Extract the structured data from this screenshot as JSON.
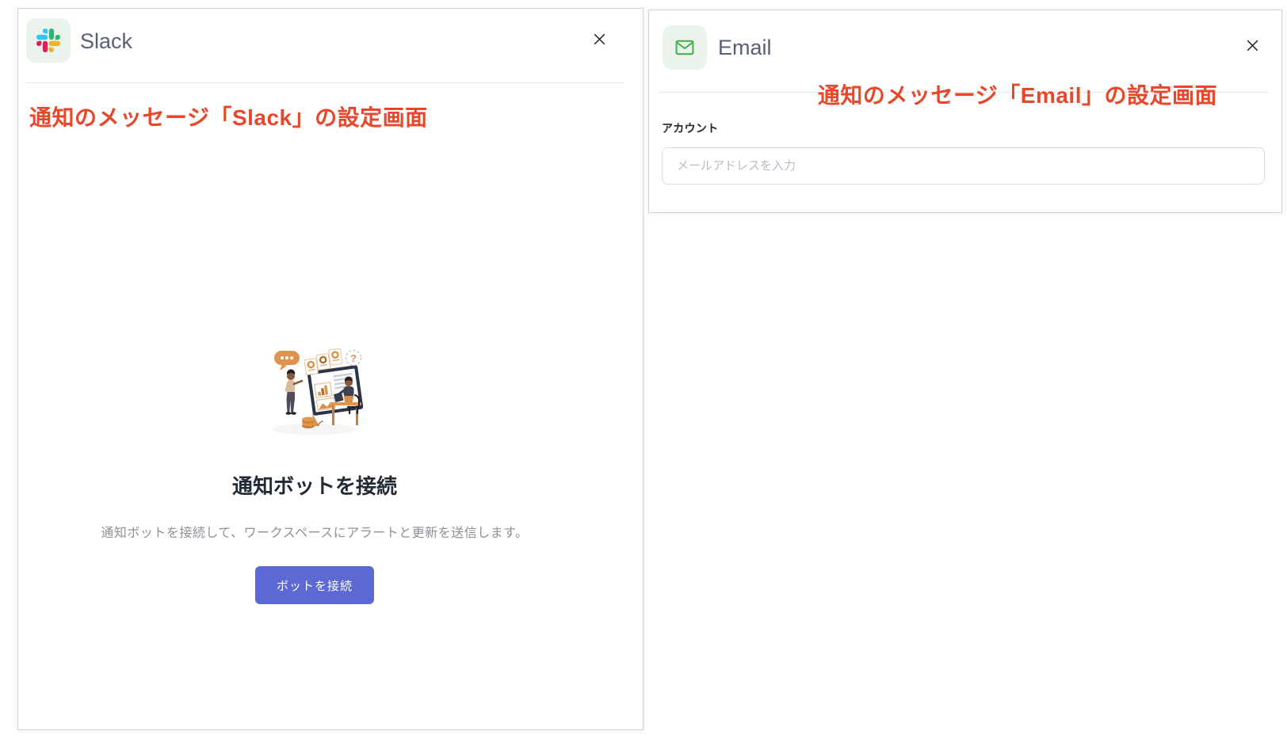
{
  "colors": {
    "annotation_red": "#E8472C",
    "primary_button_indigo": "#5C69D4",
    "panel_title_gray": "#566077",
    "icon_tile_mint": "#EAF4EC",
    "email_icon_green": "#4CAF50",
    "slack_logo": {
      "blue": "#36C5F0",
      "green": "#2EB67D",
      "red": "#E01E5A",
      "yellow": "#ECB22E"
    }
  },
  "icons": {
    "slack": "slack-pinwheel",
    "email": "envelope-outline",
    "close": "x-cross",
    "illustration": "people-presenting-dashboard"
  },
  "slack_panel": {
    "title": "Slack",
    "annotation": "通知のメッセージ「Slack」の設定画面",
    "empty_state": {
      "heading": "通知ボットを接続",
      "description": "通知ボットを接続して、ワークスペースにアラートと更新を送信します。",
      "connect_button_label": "ボットを接続"
    }
  },
  "email_panel": {
    "title": "Email",
    "annotation": "通知のメッセージ「Email」の設定画面",
    "account_label": "アカウント",
    "email_input": {
      "value": "",
      "placeholder": "メールアドレスを入力"
    }
  }
}
